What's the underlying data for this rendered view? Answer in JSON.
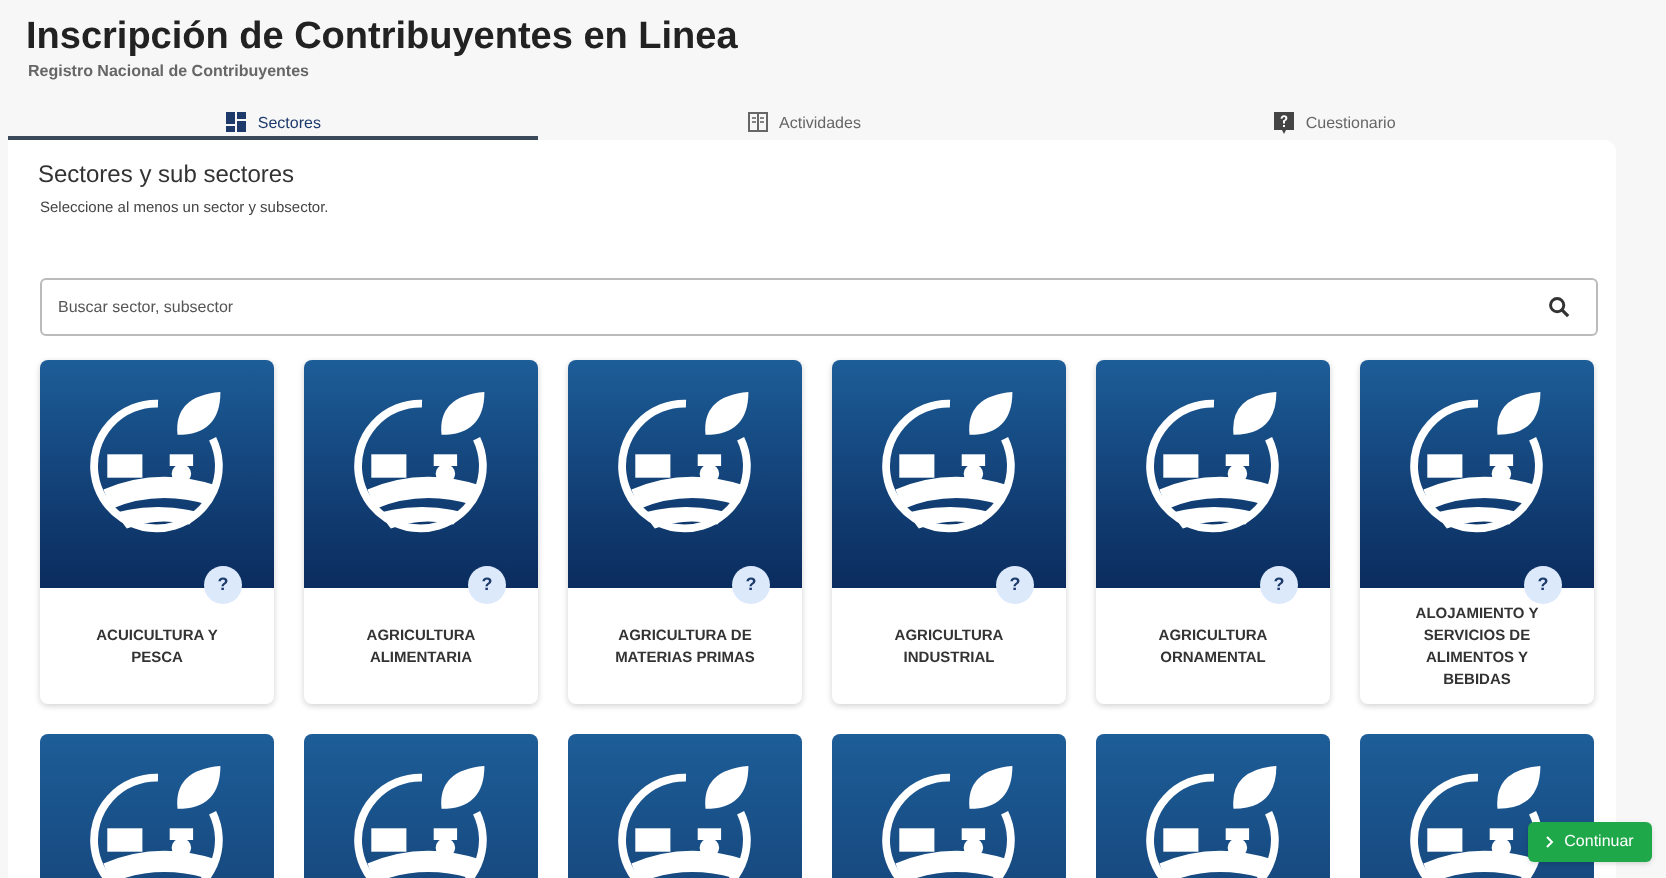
{
  "header": {
    "title": "Inscripción de Contribuyentes en Linea",
    "subtitle": "Registro Nacional de Contribuyentes"
  },
  "tabs": [
    {
      "label": "Sectores",
      "kind": "grid",
      "selected": true
    },
    {
      "label": "Actividades",
      "kind": "list",
      "selected": false
    },
    {
      "label": "Cuestionario",
      "kind": "question",
      "selected": false
    }
  ],
  "panel": {
    "title": "Sectores y sub sectores",
    "instructions": "Seleccione al menos un sector y subsector.",
    "search": {
      "placeholder": "Buscar sector, subsector"
    }
  },
  "sectors": [
    {
      "label": "ACUICULTURA Y PESCA",
      "help": "?"
    },
    {
      "label": "AGRICULTURA ALIMENTARIA",
      "help": "?"
    },
    {
      "label": "AGRICULTURA DE MATERIAS PRIMAS",
      "help": "?"
    },
    {
      "label": "AGRICULTURA INDUSTRIAL",
      "help": "?"
    },
    {
      "label": "AGRICULTURA ORNAMENTAL",
      "help": "?"
    },
    {
      "label": "ALOJAMIENTO Y SERVICIOS DE ALIMENTOS Y BEBIDAS",
      "help": "?"
    }
  ],
  "continue_button": {
    "label": "Continuar"
  }
}
